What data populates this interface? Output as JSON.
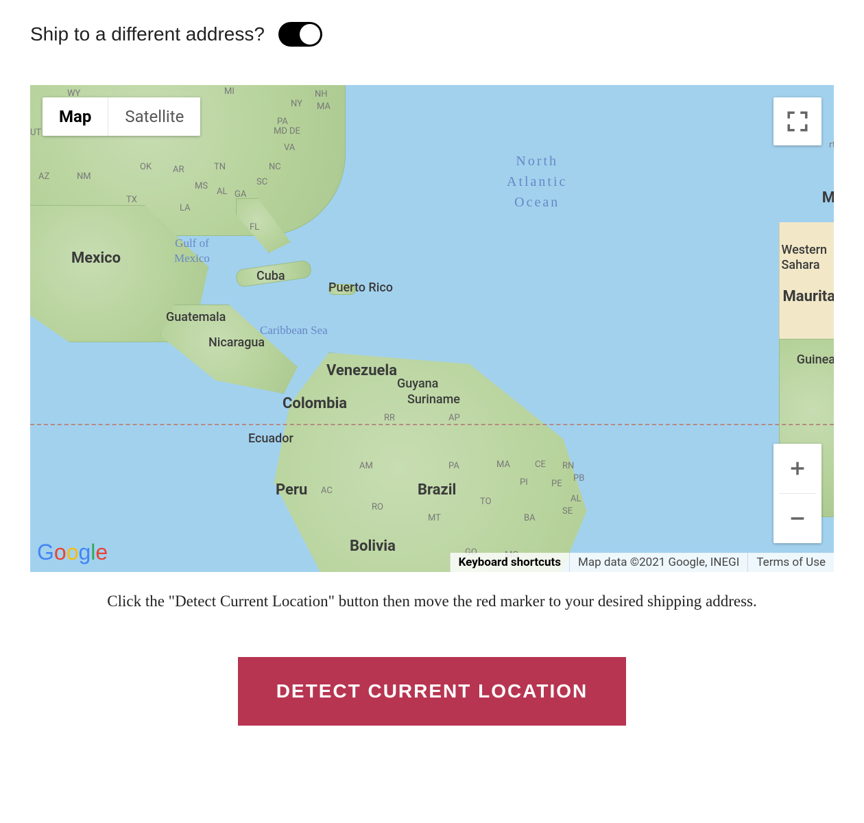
{
  "header": {
    "title": "Ship to a different address?",
    "toggle_on": true
  },
  "map": {
    "type_buttons": {
      "map": "Map",
      "satellite": "Satellite",
      "active": "map"
    },
    "water_labels": {
      "atlantic_l1": "North",
      "atlantic_l2": "Atlantic",
      "atlantic_l3": "Ocean",
      "gulf_l1": "Gulf of",
      "gulf_l2": "Mexico",
      "caribbean": "Caribbean Sea"
    },
    "country_labels": {
      "mexico": "Mexico",
      "cuba": "Cuba",
      "puertorico": "Puerto Rico",
      "guatemala": "Guatemala",
      "nicaragua": "Nicaragua",
      "venezuela": "Venezuela",
      "guyana": "Guyana",
      "suriname": "Suriname",
      "colombia": "Colombia",
      "ecuador": "Ecuador",
      "peru": "Peru",
      "bolivia": "Bolivia",
      "brazil": "Brazil",
      "wsahara": "Western\nSahara",
      "mauritania": "Maurita",
      "guinea": "Guinea",
      "mpartial": "M",
      "rtpartial": "rt"
    },
    "us_states": [
      "WY",
      "MI",
      "NH",
      "NY",
      "MA",
      "PA",
      "MD",
      "DE",
      "VA",
      "UT",
      "AZ",
      "NM",
      "OK",
      "AR",
      "TN",
      "NC",
      "SC",
      "MS",
      "AL",
      "GA",
      "TX",
      "LA",
      "FL"
    ],
    "br_states": [
      "RR",
      "AP",
      "AM",
      "PA",
      "MA",
      "CE",
      "RN",
      "PB",
      "PI",
      "PE",
      "AL",
      "SE",
      "AC",
      "RO",
      "MT",
      "TO",
      "BA",
      "GO",
      "MG"
    ],
    "footer": {
      "shortcuts": "Keyboard shortcuts",
      "attribution": "Map data ©2021 Google, INEGI",
      "terms": "Terms of Use"
    },
    "logo": "Google"
  },
  "caption": "Click the \"Detect Current Location\" button then move the red marker to your desired shipping address.",
  "detect_button": "DETECT CURRENT LOCATION"
}
